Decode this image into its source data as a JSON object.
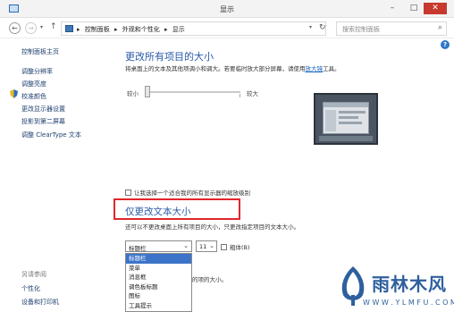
{
  "window": {
    "title": "显示",
    "min": "–",
    "max": "□",
    "close": "✕"
  },
  "nav": {
    "back": "←",
    "forward": "→",
    "recent": "▾",
    "up": "↑",
    "refresh": "↻"
  },
  "breadcrumb": {
    "sep": "▸",
    "items": [
      "控制面板",
      "外观和个性化",
      "显示"
    ],
    "dropdown": "▾"
  },
  "search": {
    "placeholder": "搜索控制面板",
    "icon": "search-icon"
  },
  "sidebar": {
    "home": "控制面板主页",
    "items": [
      "调整分辨率",
      "调整亮度",
      "校准颜色",
      "更改显示器设置",
      "投影到第二屏幕",
      "调整 ClearType 文本"
    ],
    "see_also": "另请参阅",
    "see_also_items": [
      "个性化",
      "设备和打印机"
    ]
  },
  "help": "?",
  "section1": {
    "title": "更改所有项目的大小",
    "desc": "将桌面上的文本及其他项调小和调大。若要临时放大部分屏幕，请使用",
    "link": "放大镜",
    "desc_end": "工具。",
    "slider_min": "较小",
    "slider_max": "较大",
    "slider_value": 0
  },
  "custom_check": {
    "label": "让我选择一个适合我的所有显示器的缩放级别",
    "checked": false
  },
  "section2": {
    "title": "仅更改文本大小",
    "desc": "还可以不更改桌面上所有项目的大小，只更改指定项目的文本大小。"
  },
  "text_item": {
    "selected": "标题栏",
    "arrow": "⌄",
    "options": [
      "标题栏",
      "菜单",
      "消息框",
      "调色板标题",
      "图标",
      "工具提示"
    ],
    "size": "11",
    "bold_label": "粗体(B)",
    "bold_checked": false
  },
  "tail_text": "的项的大小。",
  "watermark": {
    "title": "雨林木风",
    "url": "W W W . Y L M F U . C O M"
  },
  "colors": {
    "accent": "#2a5aa8",
    "highlight": "#e0262a",
    "selection": "#3b74c9"
  }
}
